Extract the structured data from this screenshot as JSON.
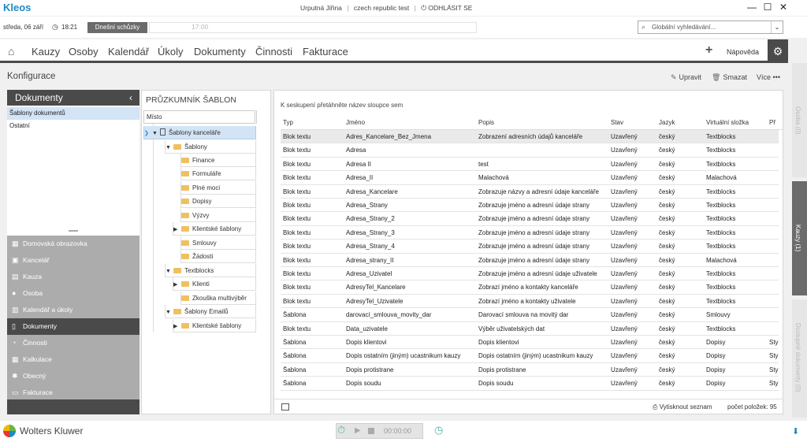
{
  "app": {
    "logo": "Kleos"
  },
  "user_info": {
    "name": "Urputná Jiřina",
    "env": "czech republic test",
    "logout": "ODHLÁSIT SE",
    "sep": "|"
  },
  "window_controls": {
    "minimize": "—",
    "maximize": "☐",
    "close": "✕"
  },
  "infobar": {
    "date": "středa, 06 září",
    "time": "18:21",
    "meetings_button": "Dnešní schůzky",
    "timeline_label": "17:00"
  },
  "search": {
    "placeholder": "Globální vyhledávání..."
  },
  "nav": {
    "items": [
      "Kauzy",
      "Osoby",
      "Kalendář",
      "Úkoly",
      "Dokumenty",
      "Činnosti",
      "Fakturace"
    ],
    "help": "Nápověda"
  },
  "config": {
    "title": "Konfigurace",
    "actions": {
      "edit": "Upravit",
      "delete": "Smazat",
      "more": "Více"
    }
  },
  "left_panel": {
    "header": "Dokumenty",
    "items": [
      "Šablony dokumentů",
      "Ostatní"
    ],
    "modules": [
      "Domovská obrazovka",
      "Kancelář",
      "Kauza",
      "Osoba",
      "Kalendář a úkoly",
      "Dokumenty",
      "Činnosti",
      "Kalkulace",
      "Obecný",
      "Fakturace"
    ]
  },
  "tree": {
    "title": "PRŮZKUMNÍK ŠABLON",
    "column": "Místo",
    "nodes": [
      "Šablony kanceláře",
      "Šablony",
      "Finance",
      "Formuláře",
      "Plné moci",
      "Dopisy",
      "Výzvy",
      "Klientské šablony",
      "Smlouvy",
      "Žádosti",
      "Textblocks",
      "Klienti",
      "Zkouška multivýběr",
      "Šablony Emailů",
      "Klientské šablony"
    ]
  },
  "grid": {
    "group_message": "K seskupení přetáhněte název sloupce sem",
    "columns": [
      "Typ",
      "Jméno",
      "Popis",
      "Stav",
      "Jazyk",
      "Virtuální složka",
      "Př"
    ],
    "rows": [
      [
        "Blok textu",
        "Adres_Kancelare_Bez_Jmena",
        "Zobrazení adresních údajů kanceláře",
        "Uzavřený",
        "český",
        "Textblocks",
        ""
      ],
      [
        "Blok textu",
        "Adresa",
        "",
        "Uzavřený",
        "český",
        "Textblocks",
        ""
      ],
      [
        "Blok textu",
        "Adresa II",
        "test",
        "Uzavřený",
        "český",
        "Textblocks",
        ""
      ],
      [
        "Blok textu",
        "Adresa_II",
        "Malachová",
        "Uzavřený",
        "český",
        "Malachová",
        ""
      ],
      [
        "Blok textu",
        "Adresa_Kancelare",
        "Zobrazuje názvy a adresní údaje kanceláře",
        "Uzavřený",
        "český",
        "Textblocks",
        ""
      ],
      [
        "Blok textu",
        "Adresa_Strany",
        "Zobrazuje jméno a adresní údaje strany",
        "Uzavřený",
        "český",
        "Textblocks",
        ""
      ],
      [
        "Blok textu",
        "Adresa_Strany_2",
        "Zobrazuje jméno a adresní údaje strany",
        "Uzavřený",
        "český",
        "Textblocks",
        ""
      ],
      [
        "Blok textu",
        "Adresa_Strany_3",
        "Zobrazuje jméno a adresní údaje strany",
        "Uzavřený",
        "český",
        "Textblocks",
        ""
      ],
      [
        "Blok textu",
        "Adresa_Strany_4",
        "Zobrazuje jméno a adresní údaje strany",
        "Uzavřený",
        "český",
        "Textblocks",
        ""
      ],
      [
        "Blok textu",
        "Adresa_strany_II",
        "Zobrazuje jméno a adresní údaje strany",
        "Uzavřený",
        "český",
        "Malachová",
        ""
      ],
      [
        "Blok textu",
        "Adresa_Uzivatel",
        "Zobrazuje jméno a adresní údaje uživatele",
        "Uzavřený",
        "český",
        "Textblocks",
        ""
      ],
      [
        "Blok textu",
        "AdresyTel_Kancelare",
        "Zobrazí jméno a kontakty kanceláře",
        "Uzavřený",
        "český",
        "Textblocks",
        ""
      ],
      [
        "Blok textu",
        "AdresyTel_Uzivatele",
        "Zobrazí jméno a kontakty uživatele",
        "Uzavřený",
        "český",
        "Textblocks",
        ""
      ],
      [
        "Šablona",
        "darovací_smlouva_movity_dar",
        "Darovací smlouva na movitý dar",
        "Uzavřený",
        "český",
        "Smlouvy",
        ""
      ],
      [
        "Blok textu",
        "Data_uzivatele",
        "Výběr uživatelských dat",
        "Uzavřený",
        "český",
        "Textblocks",
        ""
      ],
      [
        "Šablona",
        "Dopis klientovi",
        "Dopis klientovi",
        "Uzavřený",
        "český",
        "Dopisy",
        "Sty"
      ],
      [
        "Šablona",
        "Dopis ostatním (jiným) ucastnikum kauzy",
        "Dopis ostatním (jiným) ucastnikum kauzy",
        "Uzavřený",
        "český",
        "Dopisy",
        "Sty"
      ],
      [
        "Šablona",
        "Dopis protistrane",
        "Dopis protistrane",
        "Uzavřený",
        "český",
        "Dopisy",
        "Sty"
      ],
      [
        "Šablona",
        "Dopis soudu",
        "Dopis soudu",
        "Uzavřený",
        "český",
        "Dopisy",
        "Sty"
      ]
    ],
    "print": "Vytisknout seznam",
    "count": "počet položek: 95"
  },
  "side_tabs": [
    "Osoba (0)",
    "Kauzy (1)",
    "Dostupné dokumenty (0)"
  ],
  "footer": {
    "brand": "Wolters Kluwer",
    "timer": "00:00:00"
  },
  "icons": {
    "home": "home-icon",
    "gear": "gear-icon",
    "plus": "plus-icon",
    "search": "search-icon",
    "clock": "clock-icon"
  },
  "colors": {
    "accent": "#1e88c8",
    "dark_bar": "#4a4a4a",
    "selection": "#d2e4f5",
    "module_gray": "#acacac",
    "timer_teal": "#4fb6a6"
  }
}
